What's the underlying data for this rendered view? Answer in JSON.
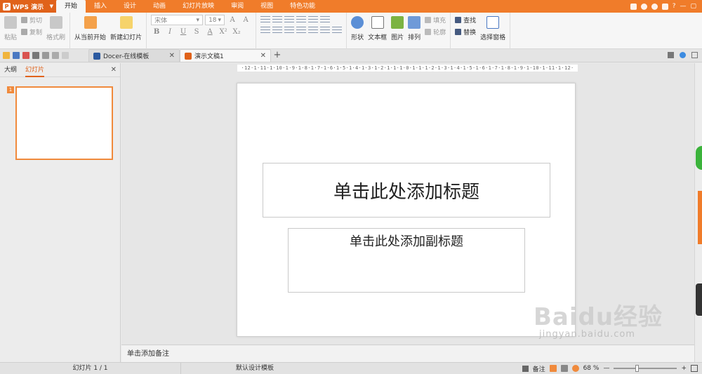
{
  "app": {
    "name": "WPS 演示",
    "menu_tabs": [
      "开始",
      "插入",
      "设计",
      "动画",
      "幻灯片放映",
      "审阅",
      "视图",
      "特色功能"
    ],
    "active_menu": "开始",
    "help": "?"
  },
  "ribbon": {
    "clipboard": {
      "paste": "粘贴",
      "cut": "剪切",
      "copy": "复制",
      "format_painter": "格式刷"
    },
    "slides": {
      "from_current": "从当前开始",
      "new_slide": "新建幻灯片"
    },
    "font": {
      "name": "宋体",
      "size": "18",
      "bold": "B",
      "italic": "I",
      "underline": "U",
      "strike": "S",
      "color": "A",
      "superscript": "X²",
      "subscript": "X₂"
    },
    "drawing": {
      "shape": "形状",
      "textbox": "文本框",
      "picture": "图片",
      "arrange": "排列",
      "fill": "填充",
      "outline": "轮廓"
    },
    "editing": {
      "find": "查找",
      "replace": "替换",
      "select_pane": "选择窗格"
    }
  },
  "tabs": [
    {
      "label": "Docer-在线模板",
      "icon": "docer-icon"
    },
    {
      "label": "演示文稿1",
      "icon": "presentation-icon"
    }
  ],
  "left_panel": {
    "tab_outline": "大纲",
    "tab_slides": "幻灯片",
    "thumb_number": "1"
  },
  "ruler": "·12·1·11·1·10·1·9·1·8·1·7·1·6·1·5·1·4·1·3·1·2·1·1·1·0·1·1·1·2·1·3·1·4·1·5·1·6·1·7·1·8·1·9·1·10·1·11·1·12·",
  "slide": {
    "title_placeholder": "单击此处添加标题",
    "subtitle_placeholder": "单击此处添加副标题"
  },
  "notes_placeholder": "单击添加备注",
  "status": {
    "slide_count": "幻灯片 1 / 1",
    "template": "默认设计模板",
    "notes": "备注",
    "zoom": "68 %",
    "zoom_fraction": 0.68
  },
  "watermark": {
    "brand": "Baidu经验",
    "url": "jingyan.baidu.com"
  },
  "colors": {
    "accent": "#f07c2a",
    "accent_dark": "#e0621a"
  }
}
